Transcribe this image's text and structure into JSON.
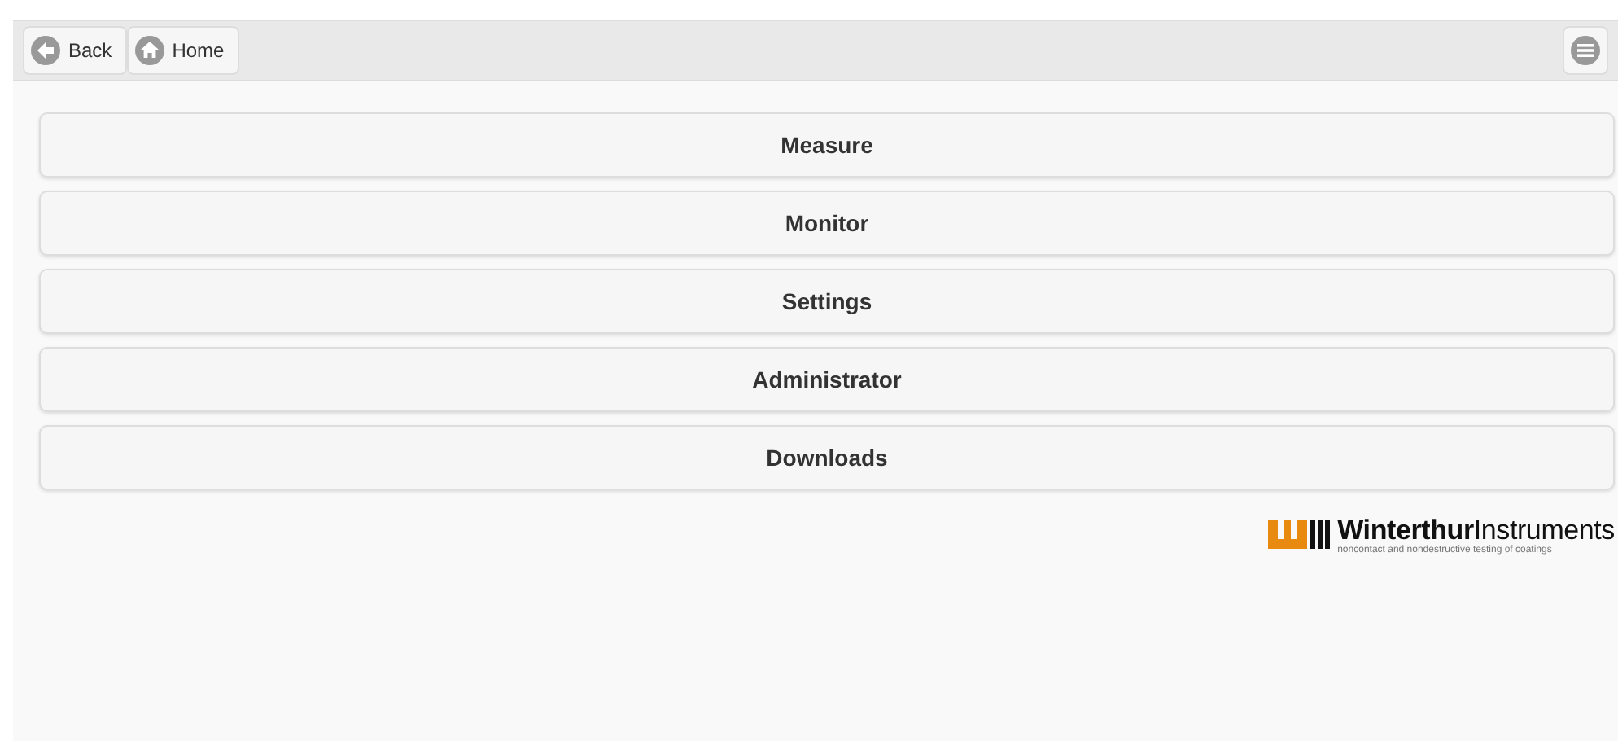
{
  "header": {
    "buttons": [
      {
        "label": "Back",
        "kind": "back"
      },
      {
        "label": "Home",
        "kind": "home"
      }
    ]
  },
  "menu": [
    {
      "label": "Measure"
    },
    {
      "label": "Monitor"
    },
    {
      "label": "Settings"
    },
    {
      "label": "Administrator"
    },
    {
      "label": "Downloads"
    }
  ],
  "logo": {
    "name": "**Winterthur**Instruments",
    "tagline": "noncontact and nondestructive testing of coatings"
  }
}
